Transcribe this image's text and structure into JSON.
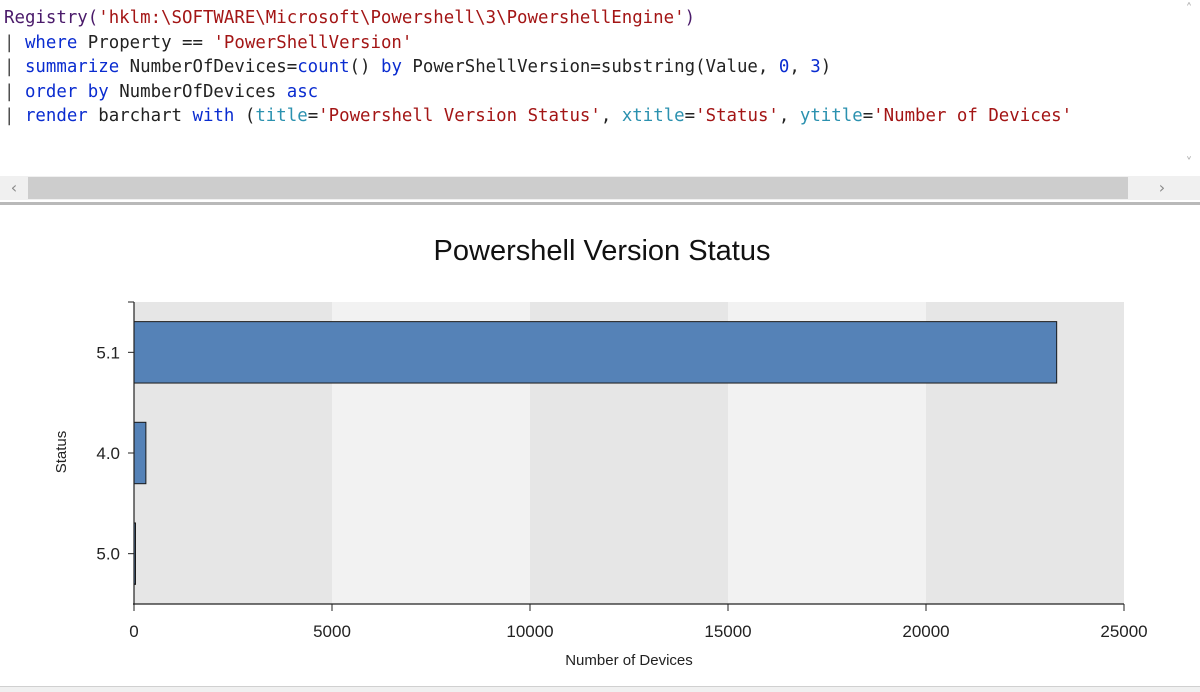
{
  "editor": {
    "lines": [
      [
        {
          "t": "Registry(",
          "c": "fn"
        },
        {
          "t": "'hklm:\\SOFTWARE\\Microsoft\\Powershell\\3\\PowershellEngine'",
          "c": "str"
        },
        {
          "t": ")",
          "c": "fn"
        }
      ],
      [
        {
          "t": "| ",
          "c": "pipe"
        },
        {
          "t": "where",
          "c": "kw"
        },
        {
          "t": " Property == ",
          "c": "plain"
        },
        {
          "t": "'PowerShellVersion'",
          "c": "str"
        }
      ],
      [
        {
          "t": "| ",
          "c": "pipe"
        },
        {
          "t": "summarize",
          "c": "kw"
        },
        {
          "t": " NumberOfDevices=",
          "c": "plain"
        },
        {
          "t": "count",
          "c": "kw"
        },
        {
          "t": "() ",
          "c": "plain"
        },
        {
          "t": "by",
          "c": "kw"
        },
        {
          "t": " PowerShellVersion=substring(Value, ",
          "c": "plain"
        },
        {
          "t": "0",
          "c": "kw"
        },
        {
          "t": ", ",
          "c": "plain"
        },
        {
          "t": "3",
          "c": "kw"
        },
        {
          "t": ")",
          "c": "plain"
        }
      ],
      [
        {
          "t": "| ",
          "c": "pipe"
        },
        {
          "t": "order by",
          "c": "kw"
        },
        {
          "t": " NumberOfDevices ",
          "c": "plain"
        },
        {
          "t": "asc",
          "c": "kw"
        }
      ],
      [
        {
          "t": "| ",
          "c": "pipe"
        },
        {
          "t": "render",
          "c": "kw"
        },
        {
          "t": " barchart ",
          "c": "plain"
        },
        {
          "t": "with",
          "c": "kw"
        },
        {
          "t": " (",
          "c": "plain"
        },
        {
          "t": "title",
          "c": "prm"
        },
        {
          "t": "=",
          "c": "plain"
        },
        {
          "t": "'Powershell Version Status'",
          "c": "str"
        },
        {
          "t": ", ",
          "c": "plain"
        },
        {
          "t": "xtitle",
          "c": "prm"
        },
        {
          "t": "=",
          "c": "plain"
        },
        {
          "t": "'Status'",
          "c": "str"
        },
        {
          "t": ", ",
          "c": "plain"
        },
        {
          "t": "ytitle",
          "c": "prm"
        },
        {
          "t": "=",
          "c": "plain"
        },
        {
          "t": "'Number of Devices'",
          "c": "str"
        }
      ]
    ]
  },
  "scroll": {
    "left_arrow": "‹",
    "right_arrow": "›",
    "up_arrow": "˄",
    "down_arrow": "˅"
  },
  "chart_data": {
    "type": "bar",
    "orientation": "horizontal",
    "title": "Powershell Version Status",
    "xlabel": "Number of Devices",
    "ylabel": "Status",
    "categories": [
      "5.1",
      "4.0",
      "5.0"
    ],
    "values": [
      23300,
      300,
      30
    ],
    "xlim": [
      0,
      25000
    ],
    "xticks": [
      "0",
      "5000",
      "10000",
      "15000",
      "20000",
      "25000"
    ],
    "bar_color": "#5582b7",
    "band_colors": [
      "#e6e6e6",
      "#f2f2f2"
    ],
    "grid": false,
    "legend": "none"
  }
}
